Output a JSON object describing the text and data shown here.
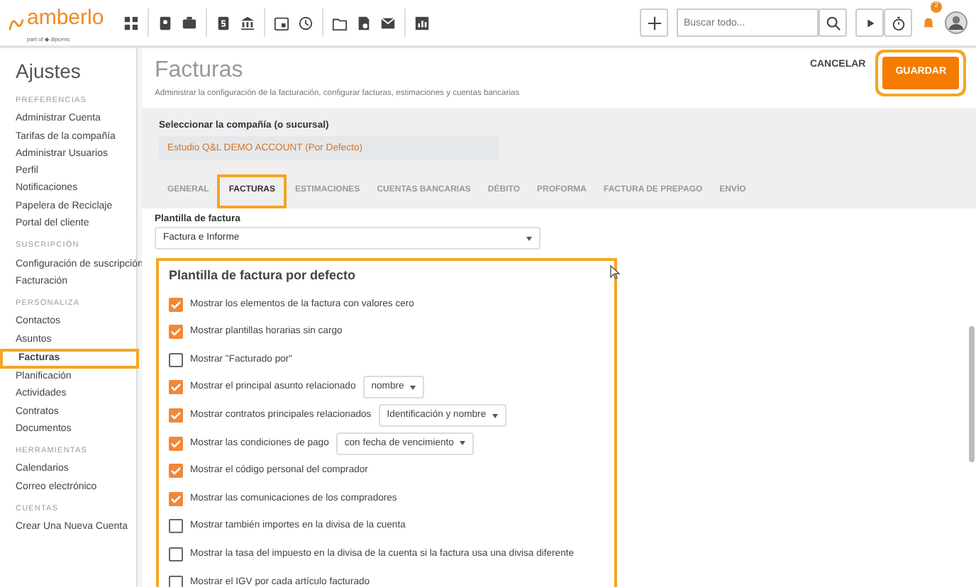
{
  "topbar": {
    "logo": "amberlo",
    "logo_tagline": "part of ◆ dipcenc",
    "search": {
      "placeholder": "Buscar todo..."
    },
    "notification_count": "2"
  },
  "sidebar": {
    "title": "Ajustes",
    "sections": [
      {
        "heading": "PREFERENCIAS",
        "items": [
          {
            "label": "Administrar Cuenta",
            "selected": false
          },
          {
            "label": "Tarifas de la compañía",
            "selected": false
          },
          {
            "label": "Administrar Usuarios",
            "selected": false
          },
          {
            "label": "Perfil",
            "selected": false
          },
          {
            "label": "Notificaciones",
            "selected": false
          },
          {
            "label": "Papelera de Reciclaje",
            "selected": false
          },
          {
            "label": "Portal del cliente",
            "selected": false
          }
        ]
      },
      {
        "heading": "SUSCRIPCIÓN",
        "items": [
          {
            "label": "Configuración de suscripción",
            "selected": false
          },
          {
            "label": "Facturación",
            "selected": false
          }
        ]
      },
      {
        "heading": "PERSONALIZA",
        "items": [
          {
            "label": "Contactos",
            "selected": false
          },
          {
            "label": "Asuntos",
            "selected": false
          },
          {
            "label": "Facturas",
            "selected": true
          },
          {
            "label": "Planificación",
            "selected": false
          },
          {
            "label": "Actividades",
            "selected": false
          },
          {
            "label": "Contratos",
            "selected": false
          },
          {
            "label": "Documentos",
            "selected": false
          }
        ]
      },
      {
        "heading": "HERRAMIENTAS",
        "items": [
          {
            "label": "Calendarios",
            "selected": false
          },
          {
            "label": "Correo electrónico",
            "selected": false
          }
        ]
      },
      {
        "heading": "CUENTAS",
        "items": [
          {
            "label": "Crear Una Nueva Cuenta",
            "selected": false
          }
        ]
      }
    ]
  },
  "page": {
    "title": "Facturas",
    "subtitle": "Administrar la configuración de la facturación, configurar facturas, estimaciones y cuentas bancarias",
    "buttons": [
      {
        "label": "CANCELAR",
        "kind": "text"
      },
      {
        "label": "GUARDAR",
        "kind": "primary"
      }
    ]
  },
  "company": {
    "label": "Seleccionar la compañía (o sucursal)",
    "value": "Estudio Q&L DEMO ACCOUNT (Por Defecto)"
  },
  "tabs": [
    {
      "label": "GENERAL",
      "selected": false
    },
    {
      "label": "FACTURAS",
      "selected": true
    },
    {
      "label": "ESTIMACIONES",
      "selected": false
    },
    {
      "label": "CUENTAS BANCARIAS",
      "selected": false
    },
    {
      "label": "DÉBITO",
      "selected": false
    },
    {
      "label": "PROFORMA",
      "selected": false
    },
    {
      "label": "FACTURA DE PREPAGO",
      "selected": false
    },
    {
      "label": "ENVÍO",
      "selected": false
    }
  ],
  "template": {
    "label": "Plantilla de factura",
    "value": "Factura e Informe"
  },
  "defaults": {
    "title": "Plantilla de factura por defecto",
    "options": [
      {
        "kind": "check",
        "label": "Mostrar los elementos de la factura con valores cero",
        "checked": true
      },
      {
        "kind": "check",
        "label": "Mostrar plantillas horarias sin cargo",
        "checked": true
      },
      {
        "kind": "check",
        "label": "Mostrar \"Facturado por\"",
        "checked": false
      },
      {
        "kind": "check_select",
        "label": "Mostrar el principal asunto relacionado",
        "checked": true,
        "value": "nombre"
      },
      {
        "kind": "check_select",
        "label": "Mostrar contratos principales relacionados",
        "checked": true,
        "value": "Identificación y nombre"
      },
      {
        "kind": "check_select",
        "label": "Mostrar las condiciones de pago",
        "checked": true,
        "value": "con fecha de vencimiento"
      },
      {
        "kind": "check",
        "label": "Mostrar el código personal del comprador",
        "checked": true
      },
      {
        "kind": "check",
        "label": "Mostrar las comunicaciones de los compradores",
        "checked": true
      },
      {
        "kind": "check",
        "label": "Mostrar también importes en la divisa de la cuenta",
        "checked": false
      },
      {
        "kind": "check",
        "label": "Mostrar la tasa del impuesto en la divisa de la cuenta si la factura usa una divisa diferente",
        "checked": false
      },
      {
        "kind": "check",
        "label": "Mostrar el IGV por cada artículo facturado",
        "checked": false
      }
    ]
  }
}
